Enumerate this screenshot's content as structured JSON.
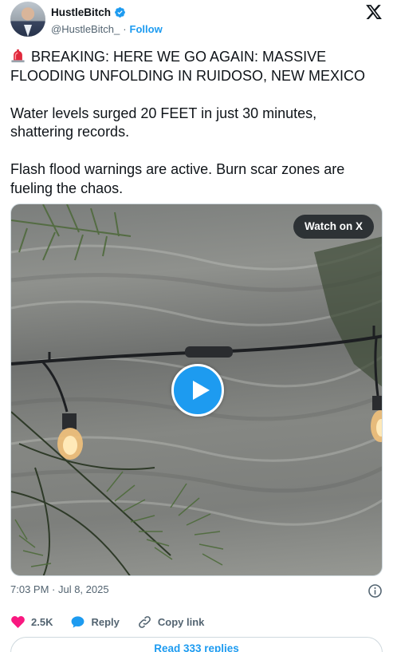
{
  "author": {
    "name": "HustleBitch",
    "handle": "@HustleBitch_",
    "separator": "·",
    "follow_label": "Follow",
    "verified": true
  },
  "tweet": {
    "paragraphs": [
      "BREAKING: HERE WE GO AGAIN: MASSIVE FLOODING UNFOLDING IN RUIDOSO, NEW MEXICO",
      "Water levels surged 20 FEET in just 30 minutes, shattering records.",
      "Flash flood warnings are active. Burn scar zones are fueling the chaos."
    ],
    "leading_emoji": "siren-icon"
  },
  "media": {
    "watch_label": "Watch on X",
    "play_icon": "play-icon"
  },
  "meta": {
    "timestamp": "7:03 PM · Jul 8, 2025"
  },
  "actions": {
    "like_count": "2.5K",
    "reply_label": "Reply",
    "copy_link_label": "Copy link"
  },
  "footer": {
    "read_replies_label": "Read 333 replies"
  },
  "colors": {
    "accent": "#1d9bf0",
    "like": "#f91880",
    "secondary_text": "#536471"
  }
}
